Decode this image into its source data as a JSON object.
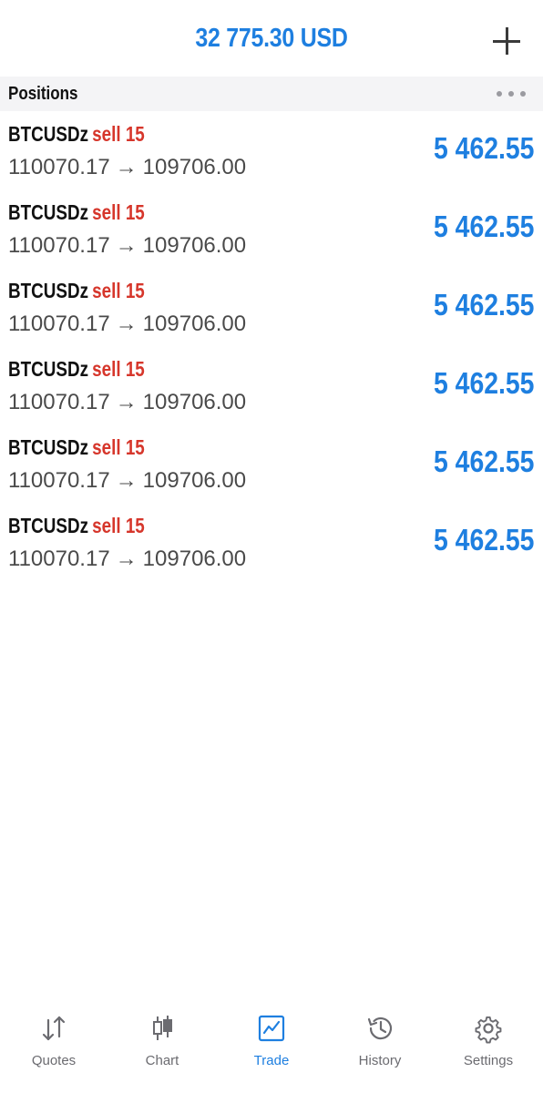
{
  "header": {
    "balance": "32 775.30 USD",
    "add_icon": "plus-icon"
  },
  "section": {
    "title": "Positions",
    "more_icon": "more-horizontal-icon"
  },
  "positions": [
    {
      "symbol": "BTCUSDz",
      "side": "sell 15",
      "open_price": "110070.17",
      "arrow": "→",
      "current_price": "109706.00",
      "profit": "5 462.55"
    },
    {
      "symbol": "BTCUSDz",
      "side": "sell 15",
      "open_price": "110070.17",
      "arrow": "→",
      "current_price": "109706.00",
      "profit": "5 462.55"
    },
    {
      "symbol": "BTCUSDz",
      "side": "sell 15",
      "open_price": "110070.17",
      "arrow": "→",
      "current_price": "109706.00",
      "profit": "5 462.55"
    },
    {
      "symbol": "BTCUSDz",
      "side": "sell 15",
      "open_price": "110070.17",
      "arrow": "→",
      "current_price": "109706.00",
      "profit": "5 462.55"
    },
    {
      "symbol": "BTCUSDz",
      "side": "sell 15",
      "open_price": "110070.17",
      "arrow": "→",
      "current_price": "109706.00",
      "profit": "5 462.55"
    },
    {
      "symbol": "BTCUSDz",
      "side": "sell 15",
      "open_price": "110070.17",
      "arrow": "→",
      "current_price": "109706.00",
      "profit": "5 462.55"
    }
  ],
  "tabs": [
    {
      "label": "Quotes",
      "icon": "quotes-arrows-icon",
      "active": false
    },
    {
      "label": "Chart",
      "icon": "candlestick-chart-icon",
      "active": false
    },
    {
      "label": "Trade",
      "icon": "trade-line-chart-icon",
      "active": true
    },
    {
      "label": "History",
      "icon": "history-clock-icon",
      "active": false
    },
    {
      "label": "Settings",
      "icon": "gear-icon",
      "active": false
    }
  ],
  "colors": {
    "accent": "#1e7fe0",
    "sell": "#d6362b",
    "section_bg": "#f4f4f6",
    "inactive_tab": "#6b6b70"
  }
}
